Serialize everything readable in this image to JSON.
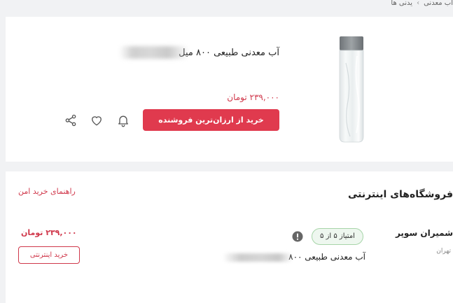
{
  "breadcrumb": {
    "items": [
      "یدنی ها",
      "آب معدنی"
    ],
    "separator": "‹"
  },
  "product": {
    "title": "آب معدنی طبیعی ۸۰۰ میل",
    "price": "۲۳۹,۰۰۰ تومان",
    "buy_button": "خرید از ارزان‌ترین فروشنده",
    "image_icon": "water-bottle-image"
  },
  "actions": {
    "bell_icon": "bell-icon",
    "heart_icon": "heart-icon",
    "share_icon": "share-icon"
  },
  "stores": {
    "title": "فروشگاه‌های اینترنتی",
    "safe_guide": "راهنمای خرید امن",
    "offers": [
      {
        "seller": "شمیران سوپر",
        "city": "تهران",
        "rating": "امتیاز ۵ از ۵",
        "title": "آب معدنی طبیعی ۸۰۰",
        "price": "۲۳۹,۰۰۰ تومان",
        "buy_label": "خرید اینترنتی"
      }
    ]
  },
  "colors": {
    "accent": "#e03a4e",
    "price": "#d0384b",
    "rating_border": "#a7d5a9",
    "background": "#f1f2f4"
  }
}
